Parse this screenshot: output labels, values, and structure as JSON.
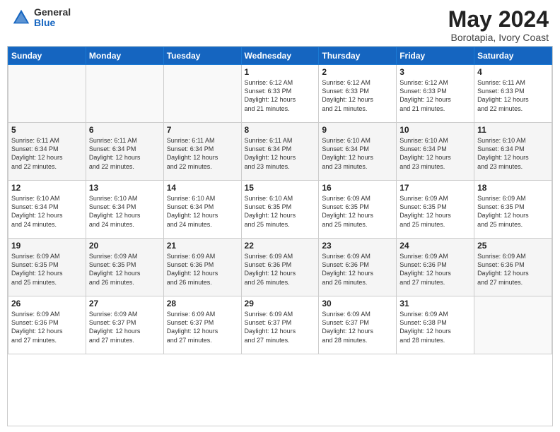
{
  "logo": {
    "general": "General",
    "blue": "Blue"
  },
  "title": "May 2024",
  "subtitle": "Borotapia, Ivory Coast",
  "days_header": [
    "Sunday",
    "Monday",
    "Tuesday",
    "Wednesday",
    "Thursday",
    "Friday",
    "Saturday"
  ],
  "weeks": [
    [
      {
        "num": "",
        "info": ""
      },
      {
        "num": "",
        "info": ""
      },
      {
        "num": "",
        "info": ""
      },
      {
        "num": "1",
        "info": "Sunrise: 6:12 AM\nSunset: 6:33 PM\nDaylight: 12 hours\nand 21 minutes."
      },
      {
        "num": "2",
        "info": "Sunrise: 6:12 AM\nSunset: 6:33 PM\nDaylight: 12 hours\nand 21 minutes."
      },
      {
        "num": "3",
        "info": "Sunrise: 6:12 AM\nSunset: 6:33 PM\nDaylight: 12 hours\nand 21 minutes."
      },
      {
        "num": "4",
        "info": "Sunrise: 6:11 AM\nSunset: 6:33 PM\nDaylight: 12 hours\nand 22 minutes."
      }
    ],
    [
      {
        "num": "5",
        "info": "Sunrise: 6:11 AM\nSunset: 6:34 PM\nDaylight: 12 hours\nand 22 minutes."
      },
      {
        "num": "6",
        "info": "Sunrise: 6:11 AM\nSunset: 6:34 PM\nDaylight: 12 hours\nand 22 minutes."
      },
      {
        "num": "7",
        "info": "Sunrise: 6:11 AM\nSunset: 6:34 PM\nDaylight: 12 hours\nand 22 minutes."
      },
      {
        "num": "8",
        "info": "Sunrise: 6:11 AM\nSunset: 6:34 PM\nDaylight: 12 hours\nand 23 minutes."
      },
      {
        "num": "9",
        "info": "Sunrise: 6:10 AM\nSunset: 6:34 PM\nDaylight: 12 hours\nand 23 minutes."
      },
      {
        "num": "10",
        "info": "Sunrise: 6:10 AM\nSunset: 6:34 PM\nDaylight: 12 hours\nand 23 minutes."
      },
      {
        "num": "11",
        "info": "Sunrise: 6:10 AM\nSunset: 6:34 PM\nDaylight: 12 hours\nand 23 minutes."
      }
    ],
    [
      {
        "num": "12",
        "info": "Sunrise: 6:10 AM\nSunset: 6:34 PM\nDaylight: 12 hours\nand 24 minutes."
      },
      {
        "num": "13",
        "info": "Sunrise: 6:10 AM\nSunset: 6:34 PM\nDaylight: 12 hours\nand 24 minutes."
      },
      {
        "num": "14",
        "info": "Sunrise: 6:10 AM\nSunset: 6:34 PM\nDaylight: 12 hours\nand 24 minutes."
      },
      {
        "num": "15",
        "info": "Sunrise: 6:10 AM\nSunset: 6:35 PM\nDaylight: 12 hours\nand 25 minutes."
      },
      {
        "num": "16",
        "info": "Sunrise: 6:09 AM\nSunset: 6:35 PM\nDaylight: 12 hours\nand 25 minutes."
      },
      {
        "num": "17",
        "info": "Sunrise: 6:09 AM\nSunset: 6:35 PM\nDaylight: 12 hours\nand 25 minutes."
      },
      {
        "num": "18",
        "info": "Sunrise: 6:09 AM\nSunset: 6:35 PM\nDaylight: 12 hours\nand 25 minutes."
      }
    ],
    [
      {
        "num": "19",
        "info": "Sunrise: 6:09 AM\nSunset: 6:35 PM\nDaylight: 12 hours\nand 25 minutes."
      },
      {
        "num": "20",
        "info": "Sunrise: 6:09 AM\nSunset: 6:35 PM\nDaylight: 12 hours\nand 26 minutes."
      },
      {
        "num": "21",
        "info": "Sunrise: 6:09 AM\nSunset: 6:36 PM\nDaylight: 12 hours\nand 26 minutes."
      },
      {
        "num": "22",
        "info": "Sunrise: 6:09 AM\nSunset: 6:36 PM\nDaylight: 12 hours\nand 26 minutes."
      },
      {
        "num": "23",
        "info": "Sunrise: 6:09 AM\nSunset: 6:36 PM\nDaylight: 12 hours\nand 26 minutes."
      },
      {
        "num": "24",
        "info": "Sunrise: 6:09 AM\nSunset: 6:36 PM\nDaylight: 12 hours\nand 27 minutes."
      },
      {
        "num": "25",
        "info": "Sunrise: 6:09 AM\nSunset: 6:36 PM\nDaylight: 12 hours\nand 27 minutes."
      }
    ],
    [
      {
        "num": "26",
        "info": "Sunrise: 6:09 AM\nSunset: 6:36 PM\nDaylight: 12 hours\nand 27 minutes."
      },
      {
        "num": "27",
        "info": "Sunrise: 6:09 AM\nSunset: 6:37 PM\nDaylight: 12 hours\nand 27 minutes."
      },
      {
        "num": "28",
        "info": "Sunrise: 6:09 AM\nSunset: 6:37 PM\nDaylight: 12 hours\nand 27 minutes."
      },
      {
        "num": "29",
        "info": "Sunrise: 6:09 AM\nSunset: 6:37 PM\nDaylight: 12 hours\nand 27 minutes."
      },
      {
        "num": "30",
        "info": "Sunrise: 6:09 AM\nSunset: 6:37 PM\nDaylight: 12 hours\nand 28 minutes."
      },
      {
        "num": "31",
        "info": "Sunrise: 6:09 AM\nSunset: 6:38 PM\nDaylight: 12 hours\nand 28 minutes."
      },
      {
        "num": "",
        "info": ""
      }
    ]
  ]
}
